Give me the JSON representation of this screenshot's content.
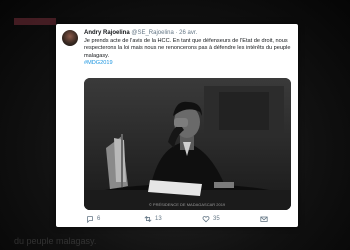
{
  "background": {
    "text_top": "",
    "text_bottom": "du peuple malagasy."
  },
  "tweet": {
    "author_name": "Andry Rajoelina",
    "handle": "@SE_Rajoelina",
    "date": "26 avr.",
    "body": "Je prends acte de l'avis de la HCC. En tant que défenseurs de l'Etat de droit, nous respecterons la loi mais nous ne renoncerons pas à défendre les intérêts du peuple malagasy.",
    "hashtag": "#MDG2019",
    "photo_credit": "© PRÉSIDENCE DE MADAGASCAR 2019",
    "replies": "6",
    "retweets": "13",
    "likes": "35"
  },
  "colors": {
    "link": "#1b95e0",
    "muted": "#657786"
  }
}
